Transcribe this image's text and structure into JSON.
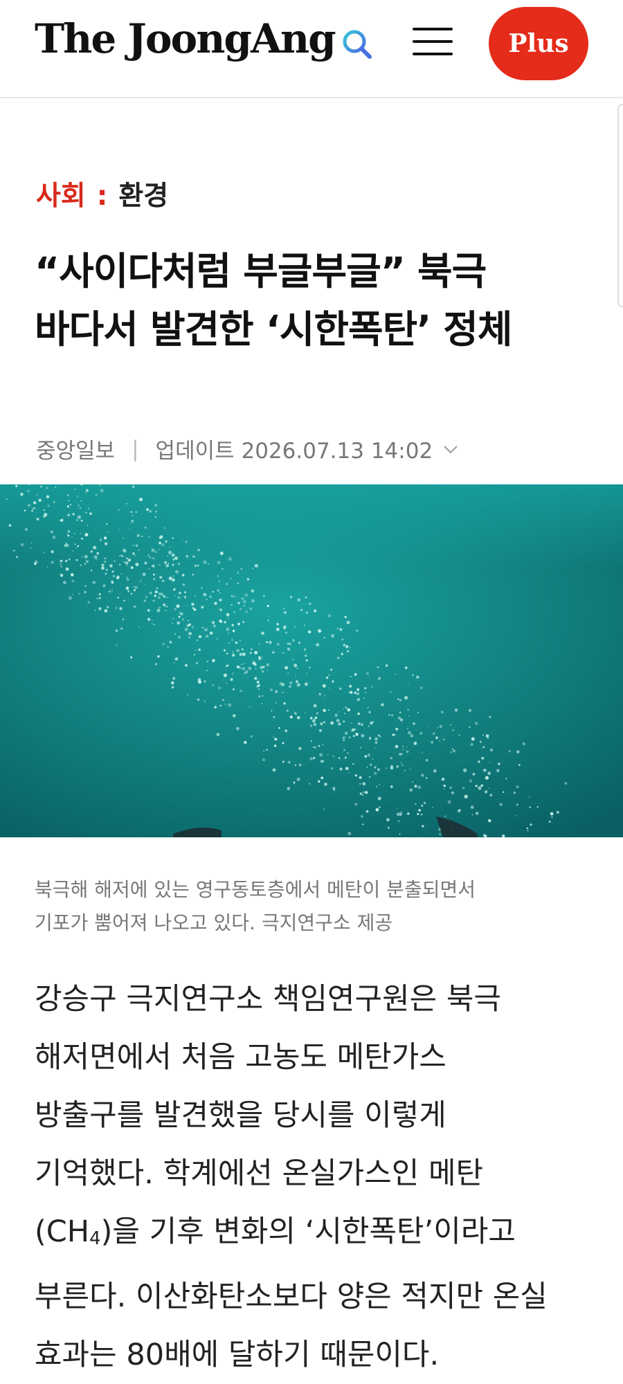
{
  "header": {
    "logo": "The JoongAng",
    "plus_label": "Plus",
    "icons": [
      "search-icon",
      "menu-icon"
    ]
  },
  "breadcrumb": {
    "section": "사회",
    "separator": ":",
    "subsection": "환경"
  },
  "article": {
    "headline_line1": "“사이다처럼 부글부글” 북극",
    "headline_line2": "바다서 발견한 ‘시한폭탄’ 정체",
    "source": "중앙일보",
    "divider": "|",
    "updated": "업데이트 2026.07.13 14:02",
    "caption_line1": "북극해 해저에 있는 영구동토층에서 메탄이 분출되면서",
    "caption_line2": "기포가 뿜어져 나오고 있다. 극지연구소 제공",
    "body_lines": [
      "강승구 극지연구소 책임연구원은 북극",
      "해저면에서 처음 고농도 메탄가스",
      "방출구를 발견했을 당시를 이렇게",
      "기억했다. 학계에선 온실가스인 메탄"
    ],
    "body_line5_pre": "(CH",
    "body_line5_sub": "4",
    "body_line5_post": ")을 기후 변화의 ‘시한폭탄’이라고",
    "body_lines_rest": [
      "부른다. 이산화탄소보다 양은 적지만 온실",
      "효과는 80배에 달하기 때문이다."
    ]
  },
  "colors": {
    "accent": "#d8291b",
    "plus_bg": "#e52b1a",
    "water_deep": "#0b6e6e",
    "water_light": "#16999a"
  }
}
